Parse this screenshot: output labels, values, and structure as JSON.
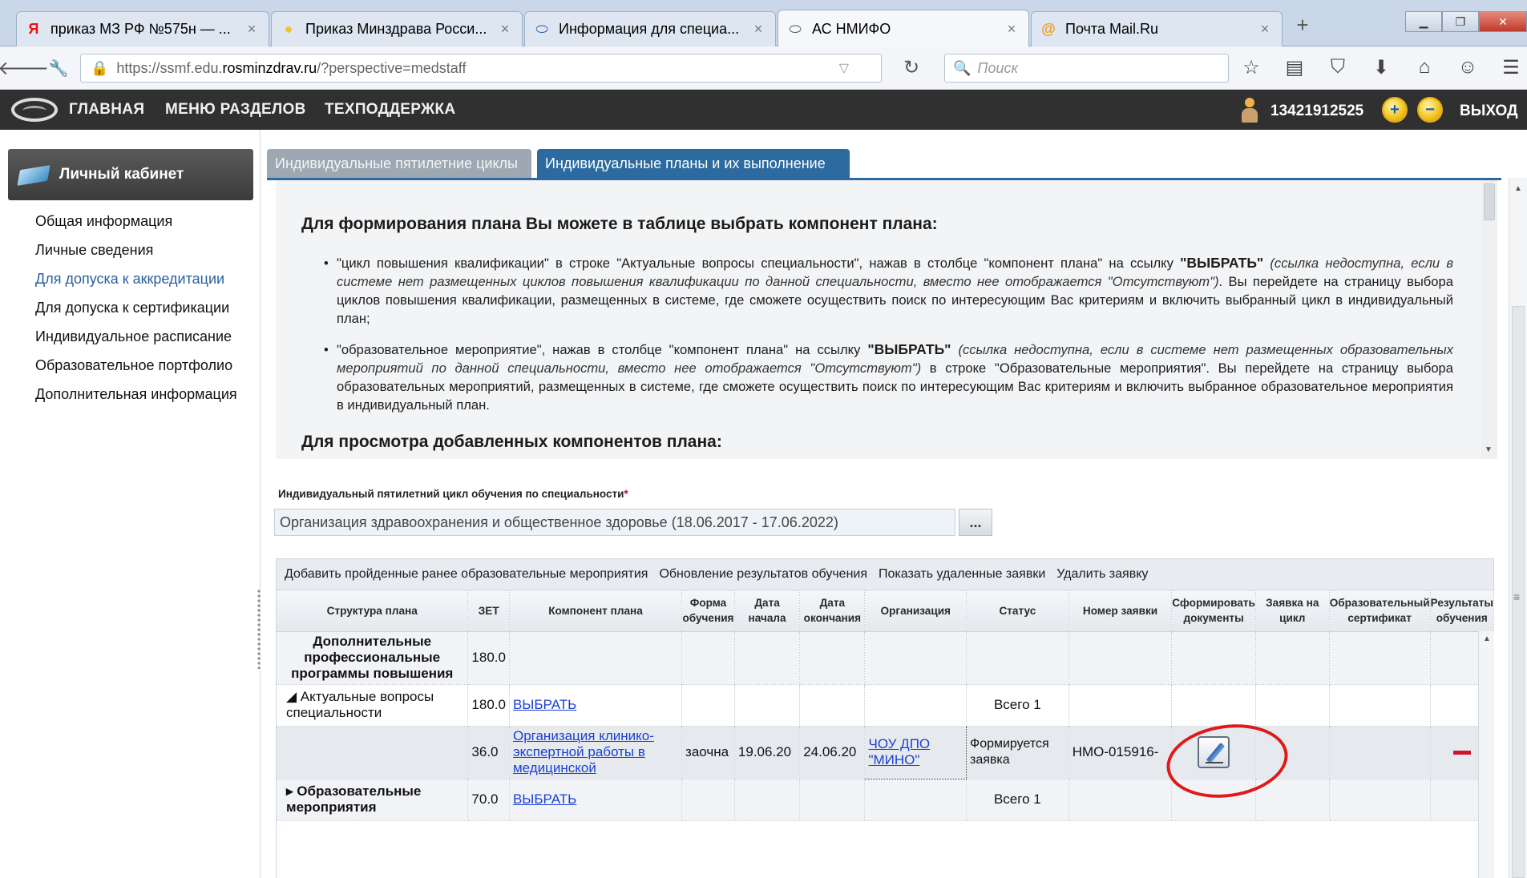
{
  "browser": {
    "tabs": [
      {
        "label": "приказ МЗ РФ №575н — ...",
        "icon": "Я",
        "icon_color": "#e11"
      },
      {
        "label": "Приказ Минздрава Росси...",
        "icon": "●",
        "icon_color": "#f2c230"
      },
      {
        "label": "Информация для специа...",
        "icon": "⬭",
        "icon_color": "#2c5fa3"
      },
      {
        "label": "АС НМИФО",
        "icon": "⬭",
        "icon_color": "#555"
      },
      {
        "label": "Почта Mail.Ru",
        "icon": "@",
        "icon_color": "#f29a14"
      }
    ],
    "tab_close": "×",
    "newtab": "+",
    "url_prefix": "https://ssmf.edu.",
    "url_host": "rosminzdrav.ru",
    "url_suffix": "/?perspective=medstaff",
    "search_placeholder": "Поиск"
  },
  "header": {
    "menu": [
      "ГЛАВНАЯ",
      "МЕНЮ РАЗДЕЛОВ",
      "ТЕХПОДДЕРЖКА"
    ],
    "username": "13421912525",
    "zoom_in": "+",
    "zoom_out": "−",
    "logout": "ВЫХОД"
  },
  "sidebar": {
    "title": "Личный кабинет",
    "items": [
      {
        "label": "Общая информация",
        "selected": false
      },
      {
        "label": "Личные сведения",
        "selected": false
      },
      {
        "label": "Для допуска к аккредитации",
        "selected": true
      },
      {
        "label": "Для допуска к сертификации",
        "selected": false
      },
      {
        "label": "Индивидуальное расписание",
        "selected": false
      },
      {
        "label": "Образовательное портфолио",
        "selected": false
      },
      {
        "label": "Дополнительная информация",
        "selected": false
      }
    ]
  },
  "content_tabs": [
    {
      "label": "Индивидуальные пятилетние циклы",
      "active": false
    },
    {
      "label": "Индивидуальные планы и их выполнение",
      "active": true
    }
  ],
  "info": {
    "heading1": "Для формирования плана Вы можете в таблице выбрать компонент плана:",
    "b1_a": "\"цикл повышения квалификации\" в строке \"Актуальные вопросы специальности\", нажав в столбце \"компонент плана\" на ссылку ",
    "b1_bold": "\"ВЫБРАТЬ\"",
    "b1_italic": " (ссылка недоступна, если в системе нет размещенных циклов повышения квалификации по данной специальности, вместо нее отображается \"Отсутствуют\")",
    "b1_c": ". Вы перейдете на страницу выбора циклов повышения квалификации, размещенных в системе, где сможете осуществить поиск по интересующим Вас критериям и включить выбранный цикл в индивидуальный план;",
    "b2_a": "\"образовательное мероприятие\", нажав в столбце \"компонент плана\" на ссылку ",
    "b2_bold": "\"ВЫБРАТЬ\"",
    "b2_italic": " (ссылка недоступна, если в системе нет размещенных образовательных мероприятий по данной специальности, вместо нее отображается \"Отсутствуют\")",
    "b2_c": " в строке \"Образовательные мероприятия\". Вы перейдете на страницу выбора образовательных мероприятий, размещенных в системе, где сможете осуществить поиск по интересующим Вас критериям и включить выбранное образовательное мероприятия в индивидуальный план.",
    "heading2": "Для просмотра добавленных компонентов плана:"
  },
  "form": {
    "label": "Индивидуальный пятилетний цикл обучения по специальности",
    "required_mark": "*",
    "value": "Организация здравоохранения и общественное здоровье (18.06.2017 - 17.06.2022)",
    "button": "..."
  },
  "toolbar": [
    "Добавить пройденные ранее образовательные мероприятия",
    "Обновление результатов обучения",
    "Показать удаленные заявки",
    "Удалить заявку"
  ],
  "table": {
    "columns": [
      "Структура плана",
      "ЗЕТ",
      "Компонент плана",
      "Форма обучения",
      "Дата начала",
      "Дата окончания",
      "Организация",
      "Статус",
      "Номер заявки",
      "Сформировать документы",
      "Заявка на цикл",
      "Образовательный сертификат",
      "Результаты обучения"
    ],
    "rows": [
      {
        "structure": "Дополнительные профессиональные программы повышения",
        "zet": "180.0",
        "component": "",
        "form": "",
        "start": "",
        "end": "",
        "org": "",
        "status": "",
        "number": ""
      },
      {
        "structure": "◢ Актуальные вопросы специальности",
        "zet": "180.0",
        "component": "ВЫБРАТЬ",
        "form": "",
        "start": "",
        "end": "",
        "org": "",
        "status": "Всего 1",
        "number": ""
      },
      {
        "structure": "",
        "zet": "36.0",
        "component": "Организация клинико-экспертной работы в медицинской",
        "form": "заочна",
        "start": "19.06.20",
        "end": "24.06.20",
        "org": "ЧОУ ДПО \"МИНО\"",
        "status": "Формируется заявка",
        "number": "НМО-015916-"
      },
      {
        "structure": "▸ Образовательные мероприятия",
        "zet": "70.0",
        "component": "ВЫБРАТЬ",
        "form": "",
        "start": "",
        "end": "",
        "org": "",
        "status": "Всего 1",
        "number": ""
      }
    ]
  },
  "colors": {
    "header_bg": "#303030",
    "tab_active": "#2c6aa0",
    "link": "#1a3fd6",
    "annotation_circle": "#e01919",
    "delete_mark": "#d0112b"
  }
}
